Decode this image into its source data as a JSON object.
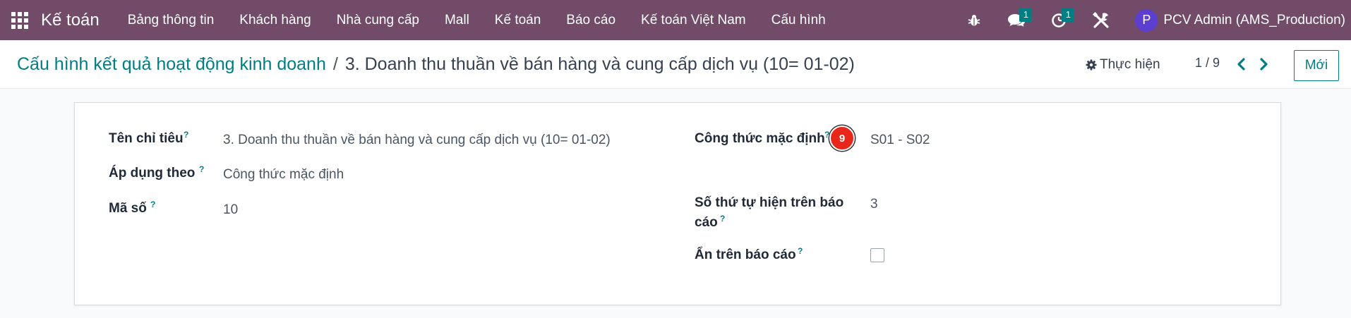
{
  "navbar": {
    "brand": "Kế toán",
    "menu": [
      "Bảng thông tin",
      "Khách hàng",
      "Nhà cung cấp",
      "Mall",
      "Kế toán",
      "Báo cáo",
      "Kế toán Việt Nam",
      "Cấu hình"
    ],
    "messages_count": "1",
    "activities_count": "1",
    "user_initial": "P",
    "user_name": "PCV Admin (AMS_Production)",
    "bg_color": "#714b67"
  },
  "control": {
    "breadcrumb_parent": "Cấu hình kết quả hoạt động kinh doanh",
    "breadcrumb_sep": "/",
    "breadcrumb_current": "3. Doanh thu thuần về bán hàng và cung cấp dịch vụ (10= 01-02)",
    "action_label": "Thực hiện",
    "pager": "1 / 9",
    "new_label": "Mới"
  },
  "form": {
    "left": {
      "name_label": "Tên chỉ tiêu",
      "name_value": "3. Doanh thu thuần về bán hàng và cung cấp dịch vụ (10= 01-02)",
      "apply_label": "Áp dụng theo",
      "apply_value": "Công thức mặc định",
      "code_label": "Mã số",
      "code_value": "10"
    },
    "right": {
      "formula_label": "Công thức mặc định",
      "formula_value": "S01 - S02",
      "marker": "9",
      "order_label_line1": "Số thứ tự hiện trên báo",
      "order_label_line2": "cáo",
      "order_value": "3",
      "hide_label": "Ẩn trên báo cáo",
      "hide_checked": false
    },
    "tooltip_mark": "?"
  }
}
